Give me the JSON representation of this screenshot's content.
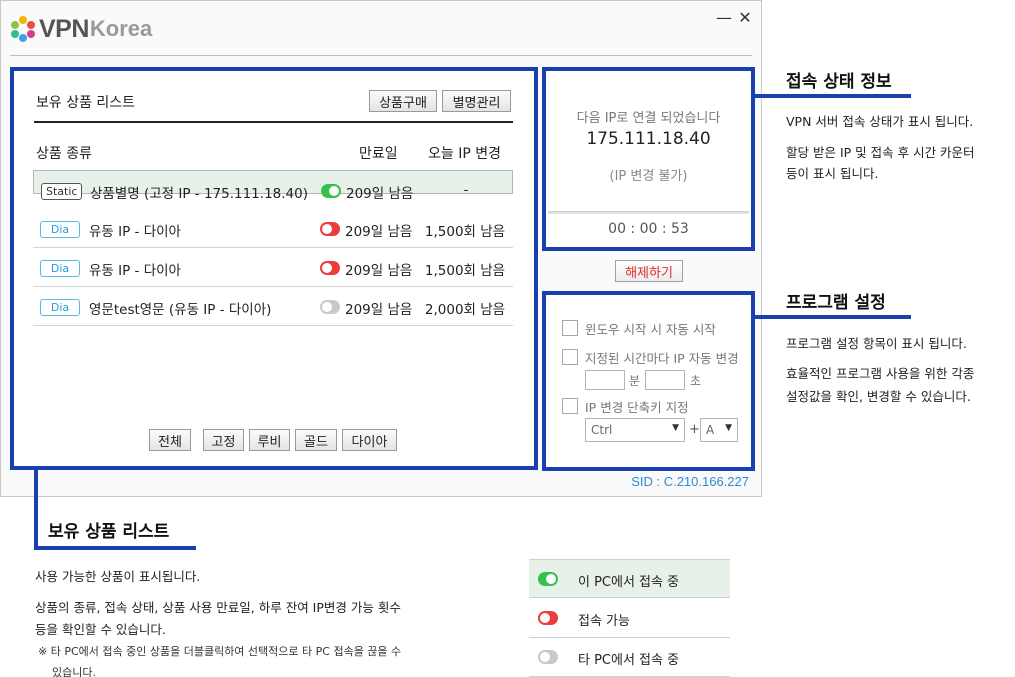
{
  "app": {
    "logo_vpn": "VPN",
    "logo_korea": "Korea",
    "minimize": "—",
    "close": "✕"
  },
  "product_list": {
    "title": "보유 상품 리스트",
    "buy_button": "상품구매",
    "alias_button": "별명관리",
    "col_type": "상품 종류",
    "col_expiry": "만료일",
    "col_ip_change": "오늘 IP 변경",
    "rows": [
      {
        "tag": "Static",
        "name": "상품별명 (고정 IP - 175.111.18.40)",
        "status": "green",
        "expiry": "209일 남음",
        "count": "-"
      },
      {
        "tag": "Dia",
        "name": "유동 IP - 다이아",
        "status": "red",
        "expiry": "209일 남음",
        "count": "1,500회 남음"
      },
      {
        "tag": "Dia",
        "name": "유동 IP - 다이아",
        "status": "red",
        "expiry": "209일 남음",
        "count": "1,500회 남음"
      },
      {
        "tag": "Dia",
        "name": "영문test영문 (유동 IP - 다이아)",
        "status": "grey",
        "expiry": "209일 남음",
        "count": "2,000회 남음"
      }
    ],
    "filters": [
      "전체",
      "고정",
      "루비",
      "골드",
      "다이아"
    ]
  },
  "status": {
    "message": "다음 IP로 연결 되었습니다",
    "ip": "175.111.18.40",
    "note": "(IP 변경 불가)",
    "timer": "00 : 00 : 53",
    "disconnect_button": "해제하기"
  },
  "settings": {
    "autostart_label": "윈도우 시작 시 자동 시작",
    "auto_change_label": "지정된 시간마다 IP 자동 변경",
    "minute_unit": "분",
    "second_unit": "초",
    "hotkey_label": "IP 변경 단축키 지정",
    "modifier_value": "Ctrl",
    "plus": "+",
    "key_value": "A",
    "sid": "SID : C.210.166.227"
  },
  "annotations": {
    "status_title": "접속 상태 정보",
    "status_desc1": "VPN 서버 접속 상태가 표시 됩니다.",
    "status_desc2a": "할당 받은 IP 및 접속 후 시간 카운터",
    "status_desc2b": "등이 표시 됩니다.",
    "settings_title": "프로그램 설정",
    "settings_desc1": "프로그램 설정 항목이 표시 됩니다.",
    "settings_desc2a": "효율적인 프로그램 사용을 위한 각종",
    "settings_desc2b": "설정값을 확인, 변경할 수 있습니다.",
    "list_title": "보유 상품 리스트",
    "list_desc1": "사용 가능한 상품이 표시됩니다.",
    "list_desc2a": "상품의 종류, 접속 상태, 상품 사용 만료일, 하루 잔여 IP변경 가능 횟수",
    "list_desc2b": "등을 확인할 수 있습니다.",
    "list_note_a": "※ 타 PC에서 접속 중인 상품을 더블클릭하여 선택적으로 타 PC 접속을 끊을 수",
    "list_note_b": "있습니다."
  },
  "legend": [
    {
      "status": "green",
      "label": "이 PC에서 접속 중"
    },
    {
      "status": "red",
      "label": "접속 가능"
    },
    {
      "status": "grey",
      "label": "타 PC에서 접속 중"
    }
  ],
  "colors": {
    "highlight": "#1a3faf",
    "connected": "#35c24b",
    "available": "#ee3b3b",
    "other_pc": "#c9c9c9",
    "sid": "#2b8bd1"
  }
}
